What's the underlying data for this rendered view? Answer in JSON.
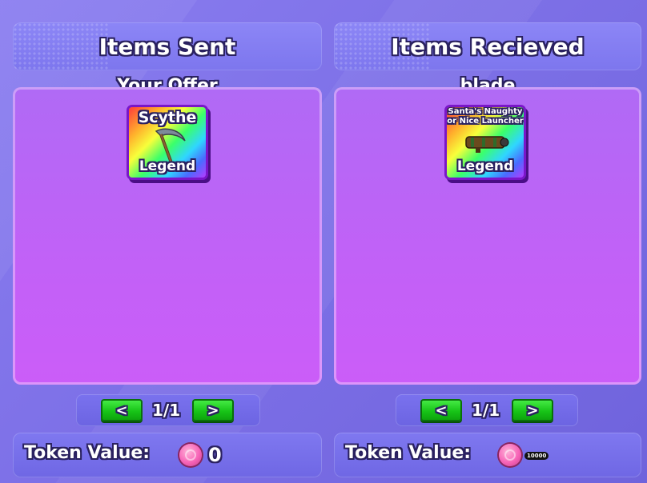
{
  "sent": {
    "header": "Items Sent",
    "subtitle": "Your Offer",
    "items": [
      {
        "name": "Scythe",
        "rarity": "Legend",
        "icon": "scythe-icon"
      }
    ],
    "page": "1/1",
    "token_label": "Token Value:",
    "token_value": "0"
  },
  "received": {
    "header": "Items Recieved",
    "subtitle": "blade",
    "items": [
      {
        "name": "Santa's Naughty or Nice Launcher",
        "rarity": "Legend",
        "icon": "launcher-icon"
      }
    ],
    "page": "1/1",
    "token_label": "Token Value:",
    "token_value": "10000"
  },
  "controls": {
    "prev": "<",
    "next": ">"
  },
  "colors": {
    "grid": "#c261f7",
    "button": "#17c417",
    "outline": "#2a2160"
  }
}
